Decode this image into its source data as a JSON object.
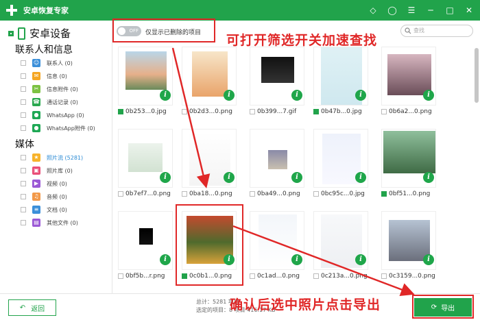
{
  "app": {
    "title": "安卓恢复专家"
  },
  "sidebar": {
    "device_label": "安卓设备",
    "sections": [
      {
        "title": "联系人和信息",
        "items": [
          {
            "label": "联系人 (0)",
            "icon": "contacts-icon",
            "color": "#3b8fd9"
          },
          {
            "label": "信息 (0)",
            "icon": "message-icon",
            "color": "#f5a623"
          },
          {
            "label": "信息附件 (0)",
            "icon": "attachment-icon",
            "color": "#7cc242"
          },
          {
            "label": "通话记录 (0)",
            "icon": "phone-icon",
            "color": "#2aa84f"
          },
          {
            "label": "WhatsApp (0)",
            "icon": "whatsapp-icon",
            "color": "#1fa855"
          },
          {
            "label": "WhatsApp附件 (0)",
            "icon": "whatsapp-icon",
            "color": "#1fa855"
          }
        ]
      },
      {
        "title": "媒体",
        "items": [
          {
            "label": "照片流 (5281)",
            "icon": "star-icon",
            "color": "#f7b32b",
            "active": true
          },
          {
            "label": "照片库 (0)",
            "icon": "gallery-icon",
            "color": "#e94e77"
          },
          {
            "label": "视频 (0)",
            "icon": "video-icon",
            "color": "#9b59d6"
          },
          {
            "label": "音频 (0)",
            "icon": "music-icon",
            "color": "#f2994a"
          },
          {
            "label": "文档 (0)",
            "icon": "document-icon",
            "color": "#3b8fd9"
          },
          {
            "label": "其他文件 (0)",
            "icon": "folder-icon",
            "color": "#9b59d6"
          }
        ]
      }
    ]
  },
  "toolbar": {
    "toggle_state": "OFF",
    "toggle_label": "仅显示已删除的项目",
    "search_placeholder": "查找"
  },
  "annotations": {
    "tip_top": "可打开筛选开关加速查找",
    "tip_bottom": "确认后选中照片点击导出"
  },
  "files": [
    {
      "name": "0b253...0.jpg",
      "checked": true
    },
    {
      "name": "0b2d3...0.png",
      "checked": false
    },
    {
      "name": "0b399...7.gif",
      "checked": false
    },
    {
      "name": "0b47b...0.jpg",
      "checked": true
    },
    {
      "name": "0b6a2...0.png",
      "checked": false
    },
    {
      "name": "0b7ef7...0.png",
      "checked": false
    },
    {
      "name": "0ba18...0.png",
      "checked": false
    },
    {
      "name": "0ba49...0.png",
      "checked": false
    },
    {
      "name": "0bc95c...0.jpg",
      "checked": false
    },
    {
      "name": "0bf51...0.png",
      "checked": true
    },
    {
      "name": "0bf5b...r.png",
      "checked": false
    },
    {
      "name": "0c0b1...0.png",
      "checked": true
    },
    {
      "name": "0c1ad...0.png",
      "checked": false
    },
    {
      "name": "0c213a...0.png",
      "checked": false
    },
    {
      "name": "0c3159...0.png",
      "checked": false
    }
  ],
  "bottom": {
    "back_label": "返回",
    "total_label": "总计：5281 项目",
    "selected_label": "选定的项目：8 项目 416.17 KB",
    "export_label": "导出"
  }
}
